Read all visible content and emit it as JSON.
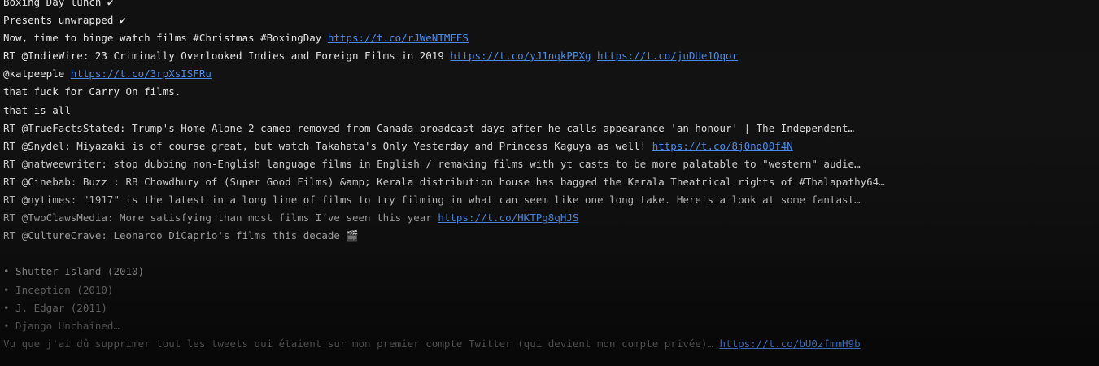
{
  "feed": {
    "lines": [
      {
        "text": "Boxing Day lunch ✔",
        "link": "",
        "link2": ""
      },
      {
        "text": "Presents unwrapped ✔",
        "link": "",
        "link2": ""
      },
      {
        "text": "Now, time to binge watch films #Christmas #BoxingDay ",
        "link": "https://t.co/rJWeNTMFES",
        "link2": ""
      },
      {
        "text": "RT @IndieWire: 23 Criminally Overlooked Indies and Foreign Films in 2019 ",
        "link": "https://t.co/yJ1nqkPPXg",
        "link2": "https://t.co/juDUe1Qqor"
      },
      {
        "text": "@katpeeple ",
        "link": "https://t.co/3rpXsISFRu",
        "link2": ""
      },
      {
        "text": "that fuck for Carry On films.",
        "link": "",
        "link2": ""
      },
      {
        "text": "that is all",
        "link": "",
        "link2": ""
      },
      {
        "text": "RT @TrueFactsStated: Trump's Home Alone 2 cameo removed from Canada broadcast days after he calls appearance 'an honour' | The Independent…",
        "link": "",
        "link2": ""
      },
      {
        "text": "RT @Snydel: Miyazaki is of course great, but watch Takahata's Only Yesterday and Princess Kaguya as well! ",
        "link": "https://t.co/8j0nd00f4N",
        "link2": ""
      },
      {
        "text": "RT @natweewriter: stop dubbing non-English language films in English / remaking films with yt casts to be more palatable to \"western\" audie…",
        "link": "",
        "link2": ""
      },
      {
        "text": "RT @Cinebab: Buzz : RB Chowdhury of (Super Good Films) &amp; Kerala distribution house has bagged the Kerala Theatrical rights of #Thalapathy64…",
        "link": "",
        "link2": ""
      },
      {
        "text": "RT @nytimes: \"1917\" is the latest in a long line of films to try filming in what can seem like one long take. Here's a look at some fantast…",
        "link": "",
        "link2": ""
      },
      {
        "text": "RT @TwoClawsMedia: More satisfying than most films I’ve seen this year ",
        "link": "https://t.co/HKTPg8qHJS",
        "link2": ""
      },
      {
        "text": "RT @CultureCrave: Leonardo DiCaprio's films this decade 🎬",
        "link": "",
        "link2": ""
      },
      {
        "text": "",
        "link": "",
        "link2": ""
      },
      {
        "text": "• Shutter Island (2010)",
        "link": "",
        "link2": ""
      },
      {
        "text": "• Inception (2010)",
        "link": "",
        "link2": ""
      },
      {
        "text": "• J. Edgar (2011)",
        "link": "",
        "link2": ""
      },
      {
        "text": "• Django Unchained…",
        "link": "",
        "link2": ""
      },
      {
        "text": "Vu que j'ai dû supprimer tout les tweets qui étaient sur mon premier compte Twitter (qui devient mon compte privée)… ",
        "link": "https://t.co/bU0zfmmH9b",
        "link2": ""
      }
    ]
  }
}
